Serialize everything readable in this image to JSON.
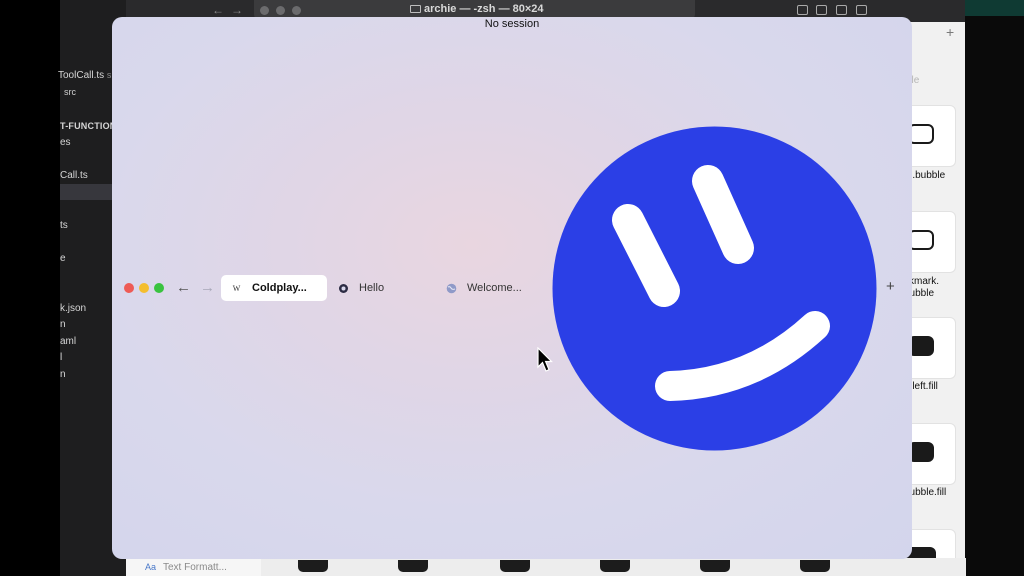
{
  "editor": {
    "file_tab": "ToolCall.ts",
    "file_tab_suffix": "s",
    "breadcrumb": "src",
    "lines": [
      "T-FUNCTION",
      "es",
      "Call.ts",
      "ts",
      "e",
      "k.json",
      "n",
      "aml",
      "l",
      "n"
    ]
  },
  "terminal": {
    "title": "archie — -zsh — 80×24"
  },
  "symbols": {
    "search_hint": "ble",
    "items": [
      ".e.bubble",
      "ckmark.\nbubble",
      "e.left.fill",
      "bubble.fill"
    ]
  },
  "bottom_bar": {
    "prefix": "Aa",
    "text": "Text Formatt..."
  },
  "window": {
    "session_status": "No session",
    "tabs": [
      {
        "label": "Coldplay...",
        "icon": "wikipedia-icon",
        "active": true
      },
      {
        "label": "Hello",
        "icon": "circle-dot-icon",
        "active": false
      },
      {
        "label": "Welcome...",
        "icon": "globe-icon",
        "active": false
      }
    ],
    "new_tab_label": "+",
    "back_label": "←",
    "forward_label": "→",
    "favicon_letter": "W"
  },
  "colors": {
    "smiley_blue": "#2b3fe6",
    "traffic_red": "#ee5b55",
    "traffic_yellow": "#f4be2e",
    "traffic_green": "#39c33f"
  }
}
